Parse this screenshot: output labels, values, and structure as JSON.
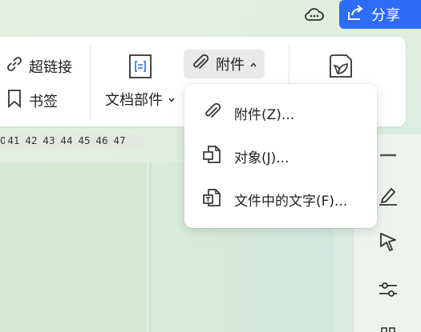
{
  "share": {
    "label": "分享"
  },
  "ribbon": {
    "hyperlink_label": "超链接",
    "bookmark_label": "书签",
    "doc_parts_label": "文档部件",
    "attachment_label": "附件"
  },
  "ruler": {
    "ticks": [
      "0",
      "41",
      "42",
      "43",
      "44",
      "45",
      "46",
      "47"
    ]
  },
  "dropdown": {
    "items": [
      {
        "label": "附件(Z)...",
        "icon": "paperclip-icon"
      },
      {
        "label": "对象(J)...",
        "icon": "object-icon"
      },
      {
        "label": "文件中的文字(F)...",
        "icon": "text-from-file-icon"
      }
    ]
  },
  "colors": {
    "accent": "#2d6cf6",
    "ribbon_bg": "#ffffff",
    "attach_active": "#e9e9e9"
  }
}
